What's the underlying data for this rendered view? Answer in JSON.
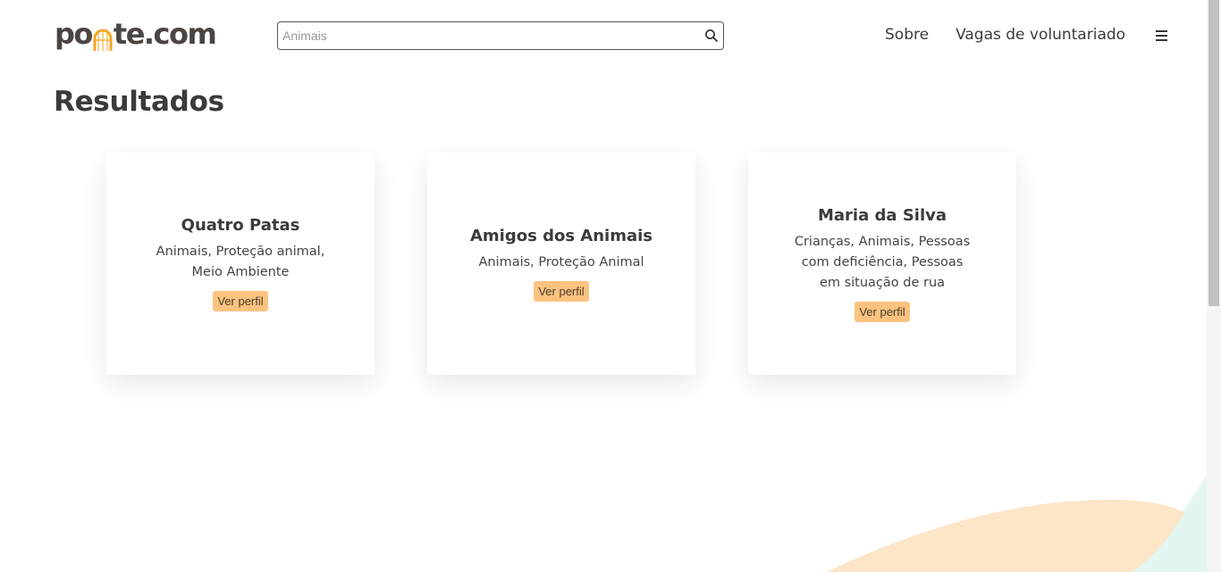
{
  "header": {
    "logo": {
      "prefix": "po",
      "suffix": "te.com",
      "accent_color": "#f5a623"
    },
    "search": {
      "value": "",
      "placeholder": "Animais",
      "icon": "search-icon"
    },
    "nav": [
      {
        "label": "Sobre"
      },
      {
        "label": "Vagas de voluntariado"
      }
    ],
    "menu_icon": "hamburger-icon"
  },
  "main": {
    "title": "Resultados",
    "results": [
      {
        "name": "Quatro Patas",
        "causes": "Animais, Proteção animal, Meio Ambiente",
        "button_label": "Ver perfil"
      },
      {
        "name": "Amigos dos Animais",
        "causes": "Animais, Proteção Animal",
        "button_label": "Ver perfil"
      },
      {
        "name": "Maria da Silva",
        "causes": "Crianças, Animais, Pessoas com deficiência, Pessoas em situação de rua",
        "button_label": "Ver perfil"
      }
    ]
  },
  "colors": {
    "button_bg": "#fbc37f",
    "decor_peach": "#fde5c8",
    "decor_mint": "#e3f6f1",
    "text_dark": "#3e3a37"
  }
}
